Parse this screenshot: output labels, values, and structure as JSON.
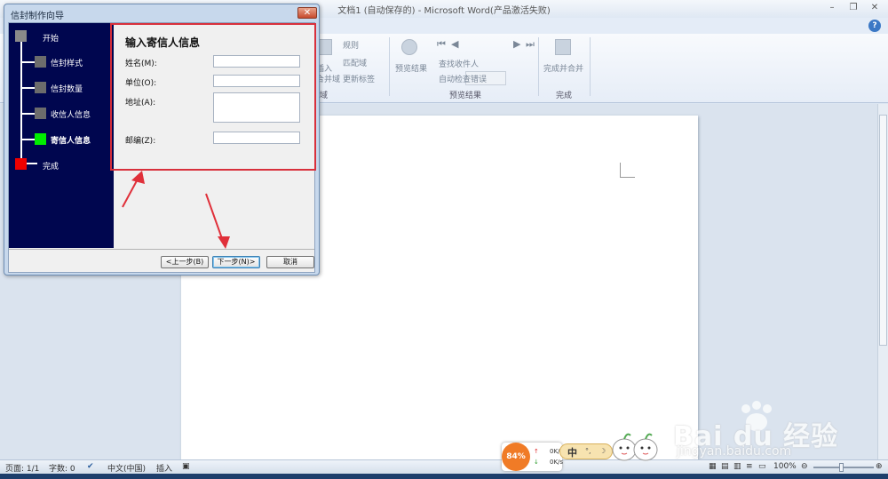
{
  "word": {
    "title": "文档1 (自动保存的) - Microsoft Word(产品激活失败)",
    "ribbon": {
      "mailmerge_items": [
        "规则",
        "匹配域",
        "更新标签"
      ],
      "insert_label": "插入",
      "field_label": "合并域",
      "group_fields_fragment": "域",
      "preview_button": "预览结果",
      "preview_items": [
        "查找收件人",
        "自动检查错误"
      ],
      "group_preview": "预览结果",
      "finish_button": "完成并合并",
      "group_finish": "完成"
    },
    "status": {
      "page": "页面: 1/1",
      "words": "字数: 0",
      "language": "中文(中国)",
      "mode": "插入",
      "zoom": "100%"
    }
  },
  "dialog": {
    "title": "信封制作向导",
    "steps": [
      {
        "label": "开始",
        "color": "#8a8a8a"
      },
      {
        "label": "信封样式",
        "color": "#6c6c6c"
      },
      {
        "label": "信封数量",
        "color": "#6c6c6c"
      },
      {
        "label": "收信人信息",
        "color": "#6c6c6c"
      },
      {
        "label": "寄信人信息",
        "color": "#00ee00",
        "current": true
      },
      {
        "label": "完成",
        "color": "#ee0000"
      }
    ],
    "panel_title": "输入寄信人信息",
    "fields": {
      "name_label": "姓名(M):",
      "company_label": "单位(O):",
      "address_label": "地址(A):",
      "postcode_label": "邮编(Z):",
      "name_value": "",
      "company_value": "",
      "address_value": "",
      "postcode_value": ""
    },
    "buttons": {
      "back": "<上一步(B)",
      "next": "下一步(N)>",
      "cancel": "取消"
    }
  },
  "widgets": {
    "net_percent": "84%",
    "net_up": "0K/s",
    "net_down": "0K/s",
    "ime_char": "中"
  },
  "watermark": {
    "brand": "Bai du 经验",
    "url": "jingyan.baidu.com"
  },
  "colors": {
    "wizard_sidebar": "#00064f",
    "highlight_frame": "#d8303c",
    "arrow": "#e0303a"
  }
}
